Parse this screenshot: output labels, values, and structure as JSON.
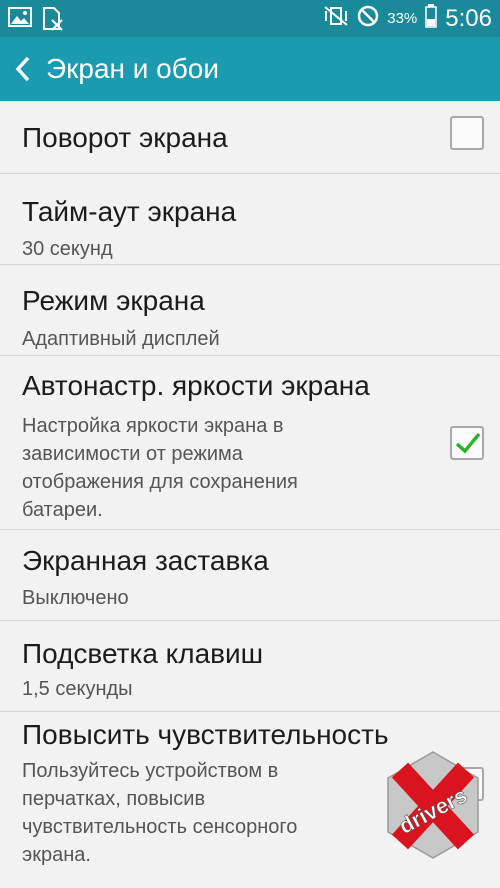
{
  "status_bar": {
    "battery_percent": "33%",
    "time": "5:06"
  },
  "app_bar": {
    "title": "Экран и обои"
  },
  "items": [
    {
      "title": "Поворот экрана",
      "checked": false
    },
    {
      "title": "Тайм-аут экрана",
      "subtitle": "30 секунд"
    },
    {
      "title": "Режим экрана",
      "subtitle": "Адаптивный дисплей"
    },
    {
      "title": "Автонастр. яркости экрана",
      "description": [
        "Настройка яркости экрана в",
        "зависимости от режима",
        "отображения для сохранения",
        "батареи."
      ],
      "checked": true
    },
    {
      "title": "Экранная заставка",
      "subtitle": "Выключено"
    },
    {
      "title": "Подсветка клавиш",
      "subtitle": "1,5 секунды"
    },
    {
      "title": "Повысить чувствительность",
      "description": [
        "Пользуйтесь устройством в",
        "перчатках, повысив",
        "чувствительность сенсорного",
        "экрана."
      ]
    }
  ],
  "watermark": {
    "text": "drivers",
    "colors": {
      "red": "#d9141e",
      "silver": "#c8c8c8"
    }
  },
  "colors": {
    "status_bar": "#1a8a9a",
    "app_bar": "#1a9bb0",
    "check": "#2db32d"
  }
}
